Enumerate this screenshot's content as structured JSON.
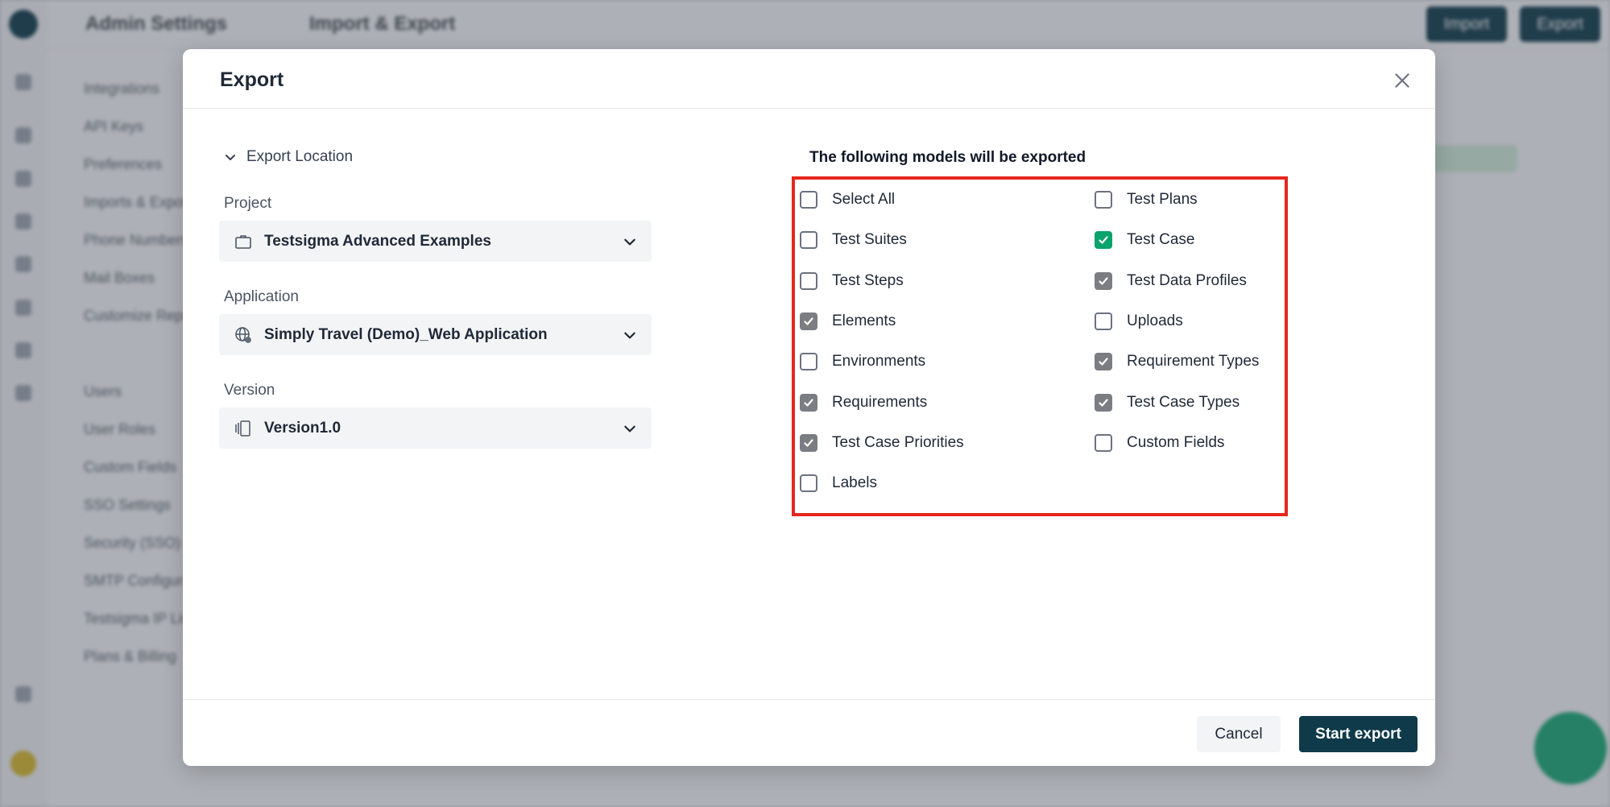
{
  "background": {
    "breadcrumb_primary": "Admin Settings",
    "breadcrumb_secondary": "Import & Export",
    "import_button": "Import",
    "export_button": "Export",
    "side_menu": [
      "Integrations",
      "API Keys",
      "Preferences",
      "Imports & Exports",
      "Phone Numbers",
      "Mail Boxes",
      "Customize Reports",
      "",
      "Users",
      "User Roles",
      "Custom Fields",
      "SSO Settings",
      "Security (SSO)",
      "SMTP Configuration",
      "Testsigma IP Listing",
      "Plans & Billing"
    ]
  },
  "modal": {
    "title": "Export",
    "close_icon": "close-icon",
    "export_location": {
      "toggle_label": "Export Location",
      "project_label": "Project",
      "project_value": "Testsigma Advanced Examples",
      "application_label": "Application",
      "application_value": "Simply Travel (Demo)_Web Application",
      "version_label": "Version",
      "version_value": "Version1.0"
    },
    "models": {
      "heading": "The following models will be exported",
      "left_column": [
        {
          "label": "Select All",
          "checked": false
        },
        {
          "label": "Test Suites",
          "checked": false
        },
        {
          "label": "Test Steps",
          "checked": false
        },
        {
          "label": "Elements",
          "checked": true
        },
        {
          "label": "Environments",
          "checked": false
        },
        {
          "label": "Requirements",
          "checked": true
        },
        {
          "label": "Test Case Priorities",
          "checked": true
        },
        {
          "label": "Labels",
          "checked": false
        }
      ],
      "right_column": [
        {
          "label": "Test Plans",
          "checked": false
        },
        {
          "label": "Test Case",
          "checked": true
        },
        {
          "label": "Test Data Profiles",
          "checked": true
        },
        {
          "label": "Uploads",
          "checked": false
        },
        {
          "label": "Requirement Types",
          "checked": true
        },
        {
          "label": "Test Case Types",
          "checked": true
        },
        {
          "label": "Custom Fields",
          "checked": false
        }
      ]
    },
    "footer": {
      "cancel_label": "Cancel",
      "start_label": "Start export"
    }
  },
  "colors": {
    "primary": "#0f3a4a",
    "checked_green": "#0aa36b",
    "checked_gray": "#7a7d82",
    "highlight": "#e5271f"
  }
}
